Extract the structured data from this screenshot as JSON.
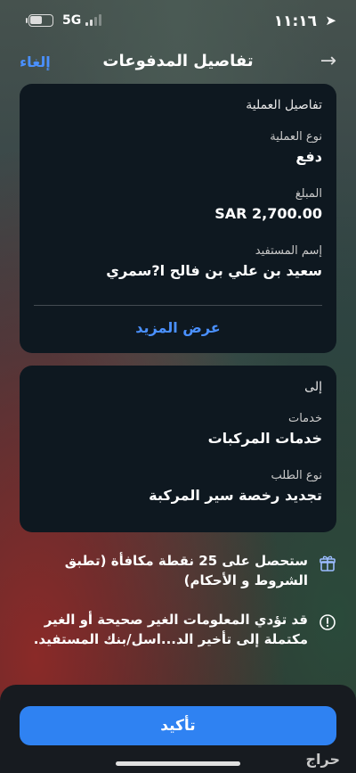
{
  "status_bar": {
    "time": "١١:١٦",
    "network": "5G",
    "battery_level": 0.55
  },
  "nav": {
    "title": "تفاصيل المدفوعات",
    "cancel_label": "إلغاء",
    "back_icon": "arrow-right-icon"
  },
  "transaction": {
    "section_title": "تفاصيل العملية",
    "type_label": "نوع العملية",
    "type_value": "دفع",
    "amount_label": "المبلغ",
    "amount_value": "SAR 2,700.00",
    "beneficiary_label": "إسم المستفيد",
    "beneficiary_value": "سعيد بن علي بن فالح ا?سمري",
    "show_more_label": "عرض المزيد"
  },
  "destination": {
    "section_title": "إلى",
    "services_label": "خدمات",
    "services_value": "خدمات المركبات",
    "request_type_label": "نوع الطلب",
    "request_type_value": "تجديد رخصة سير المركبة"
  },
  "reward_notice": {
    "icon": "gift-icon",
    "text": "ستحصل على 25 نقطة مكافأة (تطبق الشروط و الأحكام)"
  },
  "warning_notice": {
    "icon": "alert-circle-icon",
    "text": "قد تؤدي المعلومات الغير صحيحة أو الغير مكتملة إلى تأخير الد...اسل/بنك المستفيد."
  },
  "confirm_label": "تأكيد",
  "watermark": "حراج",
  "colors": {
    "accent": "#2f82f2",
    "link": "#4a90ff",
    "card": "#0e1820"
  }
}
